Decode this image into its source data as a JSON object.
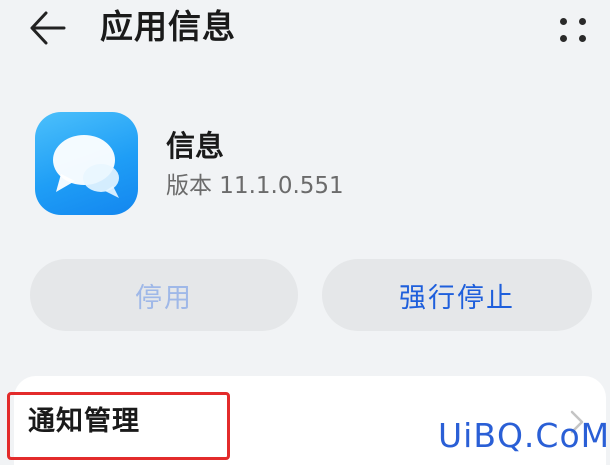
{
  "header": {
    "title": "应用信息",
    "back_icon": "arrow-left-icon",
    "more_icon": "more-dots-icon"
  },
  "app": {
    "name": "信息",
    "version": "版本 11.1.0.551",
    "icon": "messages-bubble-icon",
    "icon_color": "#1f9ef6"
  },
  "buttons": {
    "disable_label": "停用",
    "force_stop_label": "强行停止"
  },
  "list": {
    "items": [
      {
        "label": "通知管理"
      }
    ]
  },
  "colors": {
    "accent": "#1e5fdc",
    "disabled_text": "#9fb8e8",
    "highlight": "#e32b2b"
  },
  "watermark": "UiBQ.CoM"
}
